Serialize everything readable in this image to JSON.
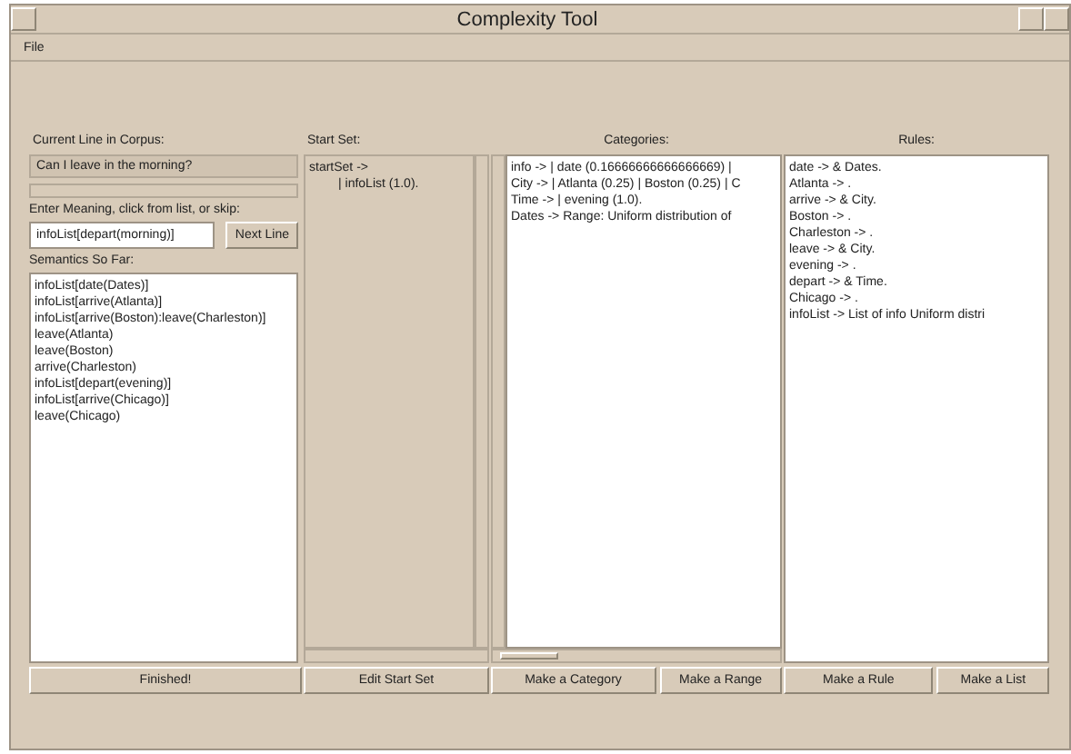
{
  "window": {
    "title": "Complexity Tool"
  },
  "menu": [
    "File"
  ],
  "corpus": {
    "label": "Current Line in Corpus:",
    "current_line": "Can I leave in the morning?"
  },
  "meaning": {
    "label": "Enter Meaning, click from list, or skip:",
    "value": "infoList[depart(morning)]",
    "button": "Next Line"
  },
  "semantics": {
    "label": "Semantics So Far:",
    "items": [
      "infoList[date(Dates)]",
      "infoList[arrive(Atlanta)]",
      "infoList[arrive(Boston):leave(Charleston)]",
      "leave(Atlanta)",
      "leave(Boston)",
      "arrive(Charleston)",
      "infoList[depart(evening)]",
      "infoList[arrive(Chicago)]",
      "leave(Chicago)"
    ],
    "button": "Finished!"
  },
  "start_set": {
    "label": "Start Set:",
    "lines": [
      "startSet ->",
      "| infoList (1.0)."
    ],
    "button": "Edit Start Set"
  },
  "categories": {
    "label": "Categories:",
    "lines": [
      "info ->  | date (0.16666666666666669) |",
      "City ->  | Atlanta (0.25) | Boston (0.25) | C",
      "Time ->  | evening (1.0).",
      "Dates -> Range: Uniform distribution of"
    ],
    "buttons": [
      "Make a Category",
      "Make a Range"
    ]
  },
  "rules": {
    "label": "Rules:",
    "lines": [
      "date ->  & Dates.",
      "Atlanta -> .",
      "arrive ->  & City.",
      "Boston -> .",
      "Charleston -> .",
      "leave ->  & City.",
      "evening -> .",
      "depart ->  & Time.",
      "Chicago -> .",
      "infoList -> List of info Uniform distri"
    ],
    "buttons": [
      "Make a Rule",
      "Make a List"
    ]
  }
}
